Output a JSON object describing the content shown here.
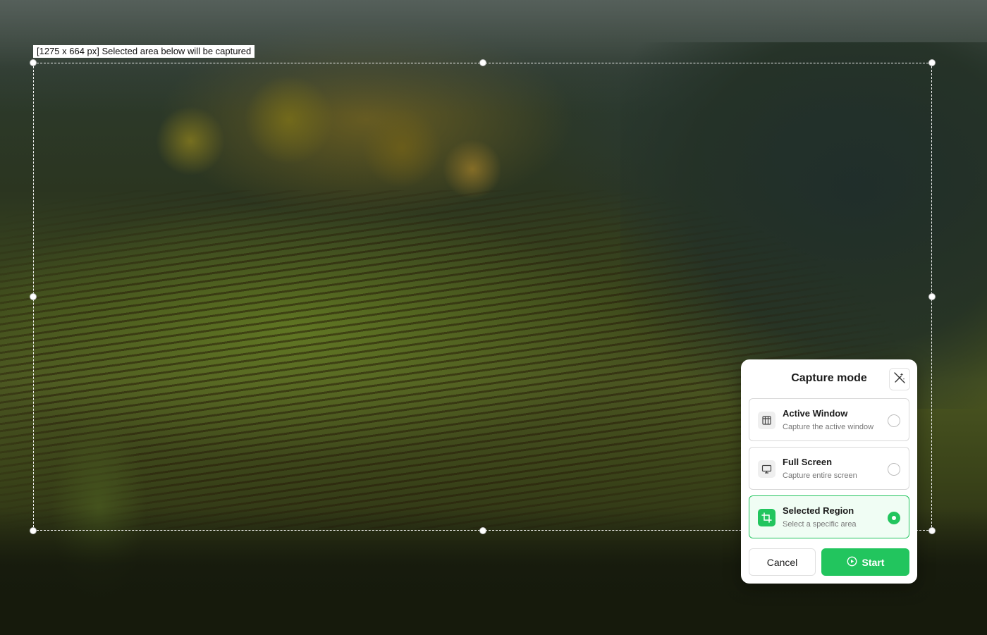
{
  "selection": {
    "size_label": "[1275 x 664 px] Selected area below will be captured"
  },
  "panel": {
    "title": "Capture mode",
    "tool_icon": "magic-wand-off-icon",
    "options": [
      {
        "title": "Active Window",
        "subtitle": "Capture the active window",
        "icon": "window-icon",
        "selected": false
      },
      {
        "title": "Full Screen",
        "subtitle": "Capture entire screen",
        "icon": "monitor-icon",
        "selected": false
      },
      {
        "title": "Selected Region",
        "subtitle": "Select a specific area",
        "icon": "crop-icon",
        "selected": true
      }
    ],
    "cancel_label": "Cancel",
    "start_label": "Start",
    "start_icon": "play-circle-icon"
  },
  "colors": {
    "accent": "#22c55e",
    "selected_bg": "#f0fdf4"
  }
}
